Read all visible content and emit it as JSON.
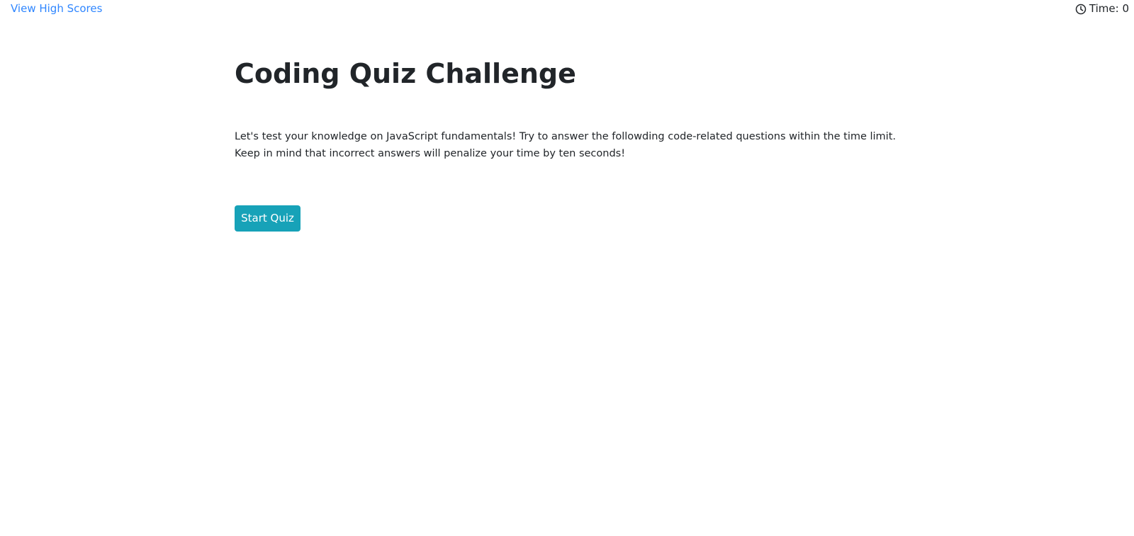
{
  "header": {
    "high_scores_link": "View High Scores",
    "timer_label": "Time: 0",
    "timer_icon": "clock-icon"
  },
  "main": {
    "title": "Coding Quiz Challenge",
    "intro_lines": [
      "Let's test your knowledge on JavaScript fundamentals! Try to answer the followding code-related questions within the time limit.",
      "Keep in mind that incorrect answers will penalize your time by ten seconds!"
    ],
    "start_button_label": "Start Quiz"
  },
  "colors": {
    "link": "#2f86ff",
    "button": "#17a2b8",
    "text": "#212529",
    "background": "#ffffff"
  }
}
